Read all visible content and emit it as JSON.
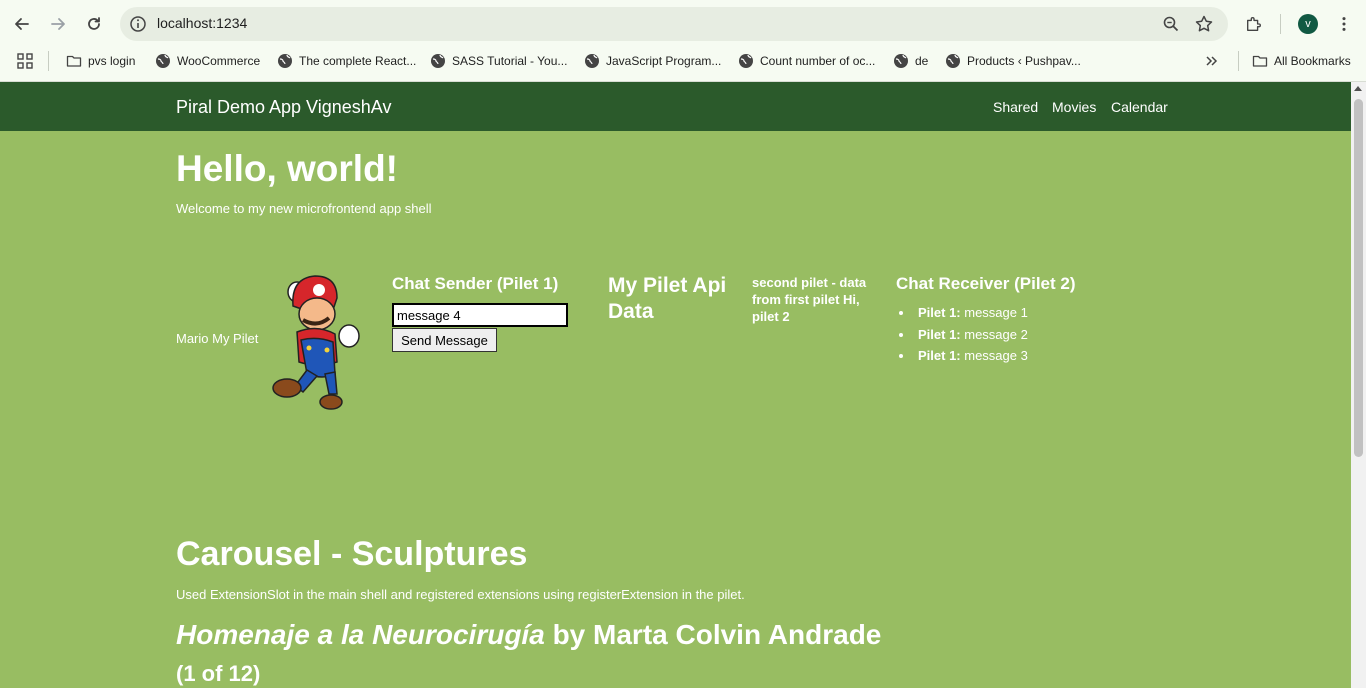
{
  "browser": {
    "url": "localhost:1234",
    "avatar_letter": "v",
    "bookmarks": [
      {
        "label": "pvs login",
        "icon": "folder-icon"
      },
      {
        "label": "WooCommerce",
        "icon": "globe-icon"
      },
      {
        "label": "The complete React...",
        "icon": "globe-icon"
      },
      {
        "label": "SASS Tutorial - You...",
        "icon": "globe-icon"
      },
      {
        "label": "JavaScript Program...",
        "icon": "globe-icon"
      },
      {
        "label": "Count number of oc...",
        "icon": "globe-icon"
      },
      {
        "label": "de",
        "icon": "globe-icon"
      },
      {
        "label": "Products ‹ Pushpav...",
        "icon": "globe-icon"
      }
    ],
    "all_bookmarks": "All Bookmarks"
  },
  "app": {
    "brand": "Piral Demo App VigneshAv",
    "nav": [
      "Shared",
      "Movies",
      "Calendar"
    ],
    "hero": {
      "title": "Hello, world!",
      "subtitle": "Welcome to my new microfrontend app shell"
    },
    "mario_label": "Mario My Pilet",
    "chat_sender": {
      "title": "Chat Sender (Pilet 1)",
      "input_value": "message 4",
      "button": "Send Message"
    },
    "pilet_api": "My Pilet Api Data",
    "second_pilet": "second pilet - data from first pilet Hi, pilet 2",
    "chat_receiver": {
      "title": "Chat Receiver (Pilet 2)",
      "messages": [
        {
          "sender": "Pilet 1:",
          "text": " message 1"
        },
        {
          "sender": "Pilet 1:",
          "text": " message 2"
        },
        {
          "sender": "Pilet 1:",
          "text": " message 3"
        }
      ]
    },
    "carousel": {
      "title": "Carousel - Sculptures",
      "subtitle": "Used ExtensionSlot in the main shell and registered extensions using registerExtension in the pilet.",
      "sculpture_name": "Homenaje a la Neurocirugía",
      "sculpture_by": " by Marta Colvin Andrade",
      "counter": "(1 of 12)"
    }
  },
  "colors": {
    "page_bg": "#98bd62",
    "appbar_bg": "#2b5a2b",
    "chrome_bg": "#f6fbf2"
  }
}
